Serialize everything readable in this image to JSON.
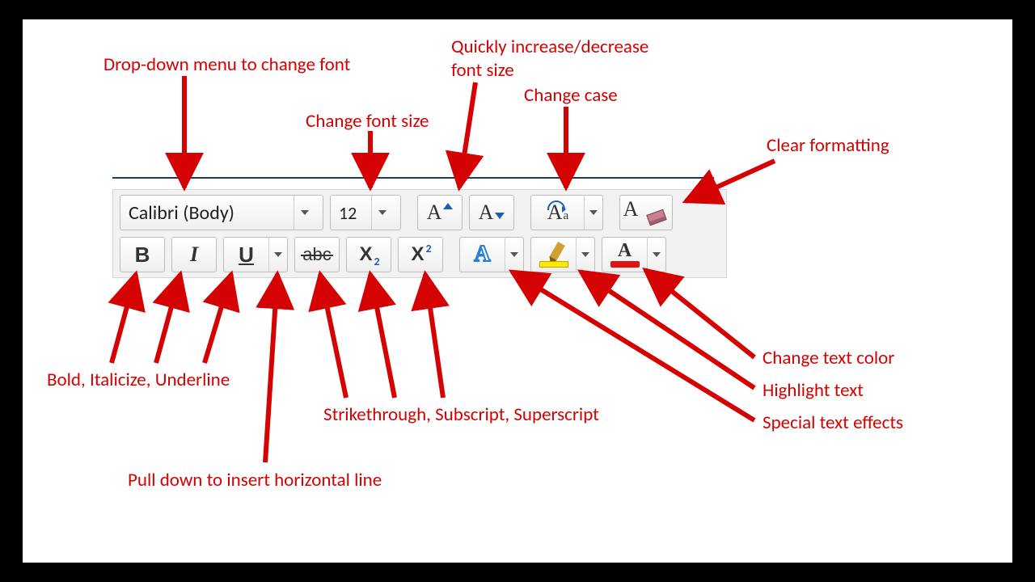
{
  "toolbar": {
    "font_name": "Calibri (Body)",
    "font_size": "12",
    "grow_glyph": "A",
    "shrink_glyph": "A",
    "case_glyph_big": "A",
    "case_glyph_small": "a",
    "clear_glyph": "A",
    "bold_glyph": "B",
    "italic_glyph": "I",
    "underline_glyph": "U",
    "strike_glyph": "abc",
    "sub_base": "X",
    "sub_small": "2",
    "sup_base": "X",
    "sup_small": "2",
    "effects_glyph": "A",
    "color_glyph": "A"
  },
  "callouts": {
    "font_menu": "Drop-down menu to change font",
    "font_size": "Change font size",
    "grow_shrink_line1": "Quickly increase/decrease",
    "grow_shrink_line2": "font size",
    "change_case": "Change case",
    "clear_formatting": "Clear formatting",
    "biu": "Bold, Italicize, Underline",
    "hr": "Pull down to insert horizontal line",
    "sss": "Strikethrough, Subscript, Superscript",
    "text_color": "Change text color",
    "highlight": "Highlight text",
    "effects": "Special text effects"
  },
  "colors": {
    "annotation": "#d40202",
    "accent_blue": "#1b5fb5",
    "highlight_swatch": "#ffe900",
    "color_swatch": "#e11414"
  }
}
